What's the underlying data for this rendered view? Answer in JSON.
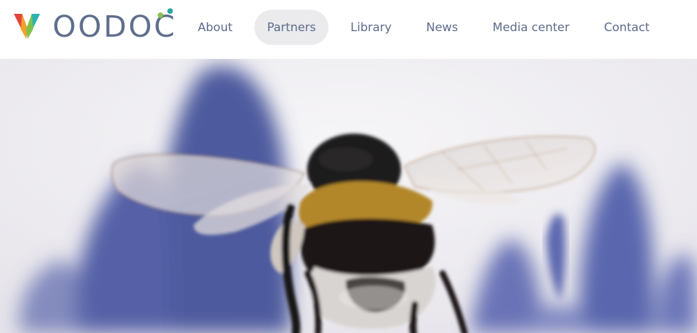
{
  "brand": {
    "name": "VOODOC",
    "logo_rest": "OODOC",
    "colors": {
      "text": "#5f6f8c",
      "v_red": "#e3433b",
      "v_orange": "#f2a22a",
      "v_green": "#7cc34a",
      "v_teal": "#2bb3b1",
      "dot_green": "#8bc34a",
      "dot_teal": "#2aa5a0"
    }
  },
  "nav": {
    "items": [
      {
        "label": "About",
        "active": false
      },
      {
        "label": "Partners",
        "active": true
      },
      {
        "label": "Library",
        "active": false
      },
      {
        "label": "News",
        "active": false
      },
      {
        "label": "Media center",
        "active": false
      },
      {
        "label": "Contact",
        "active": false
      }
    ],
    "active_bg": "#ebebee",
    "text_color": "#5d6b8a"
  },
  "hero": {
    "subject": "bumblebee-on-purple-flowers",
    "colors": {
      "background": "#eceaef",
      "flower": "#4f5a9c",
      "bee_body": "#1f1c1d",
      "bee_stripe": "#b48a2a",
      "bee_fur": "#d9d5d3",
      "wing": "#c9c3c6"
    }
  }
}
